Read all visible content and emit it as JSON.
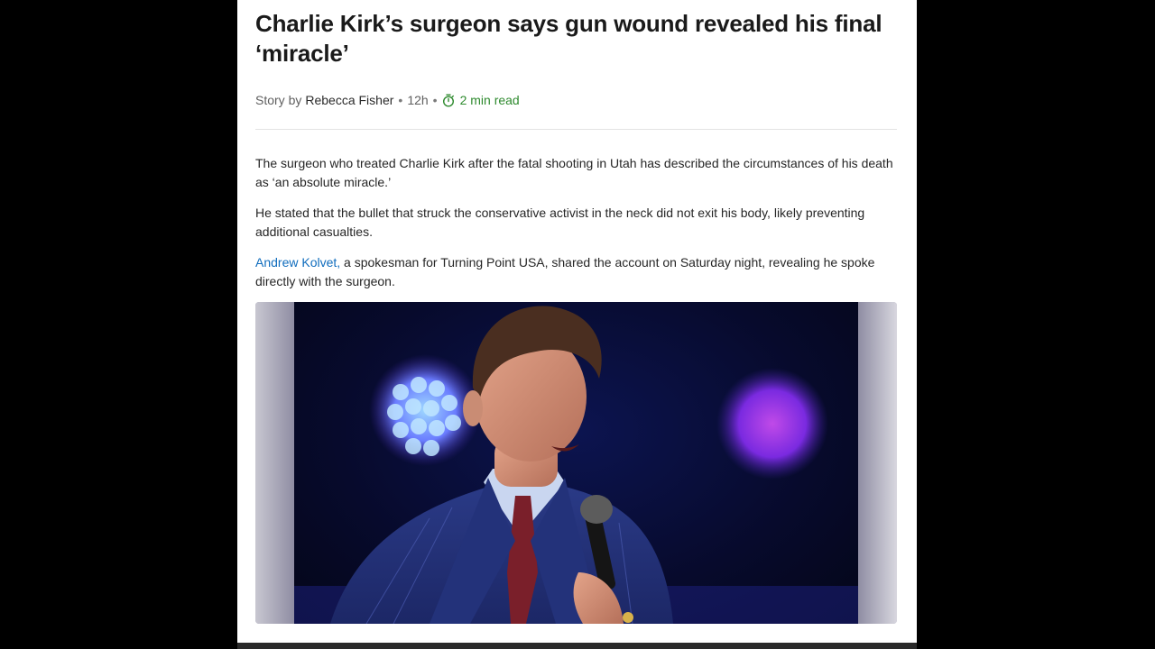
{
  "article": {
    "title": "Charlie Kirk’s surgeon says gun wound revealed his final ‘miracle’",
    "byline": {
      "prefix": "Story by",
      "author": "Rebecca Fisher",
      "separator": "•",
      "age": "12h",
      "read_time": "2 min read",
      "read_time_icon": "stopwatch-icon",
      "read_time_color": "#2e8a2e"
    },
    "paragraphs": [
      {
        "text": "The surgeon who treated Charlie Kirk after the fatal shooting in Utah has described the circumstances of his death as ‘an absolute miracle.’"
      },
      {
        "text": "He stated that the bullet that struck the conservative activist in the neck did not exit his body, likely preventing additional casualties."
      },
      {
        "link_text": "Andrew Kolvet,",
        "link_color": "#0f6cbd",
        "text": " a spokesman for Turning Point USA, shared the account on Saturday night, revealing he spoke directly with the surgeon."
      }
    ],
    "image": {
      "subject": "photo of speaker holding microphone on stage"
    }
  }
}
